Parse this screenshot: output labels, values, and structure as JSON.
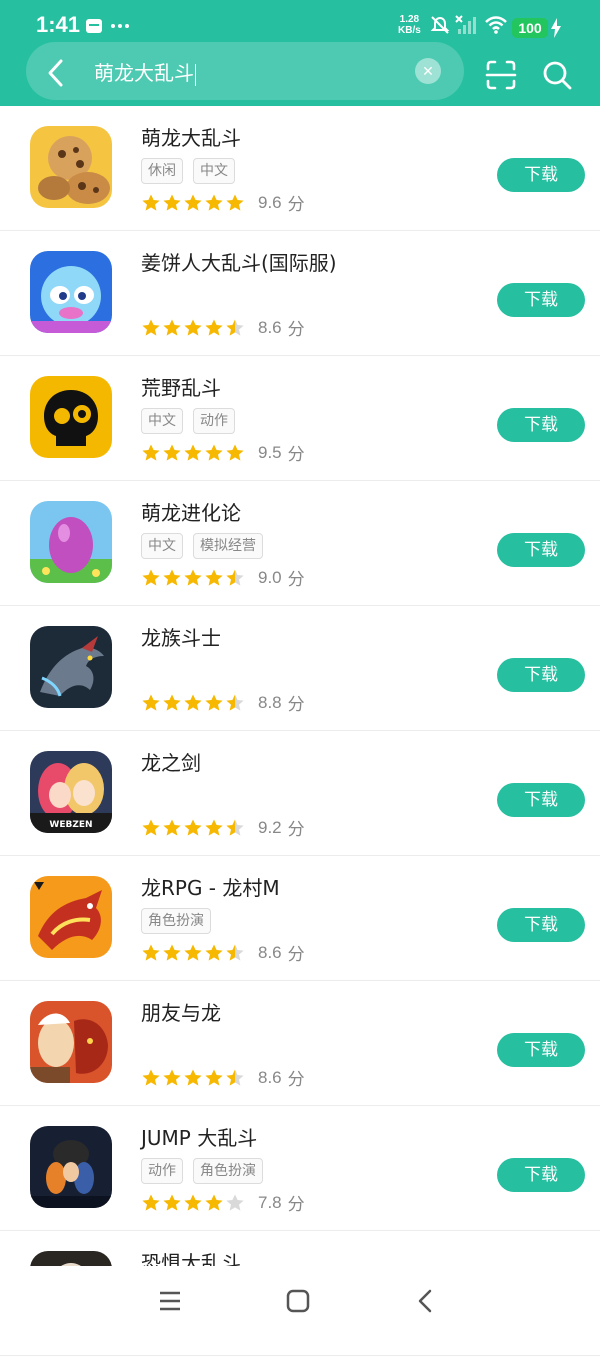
{
  "status_bar": {
    "time": "1:41",
    "net_speed_value": "1.28",
    "net_speed_unit": "KB/s",
    "battery": "100"
  },
  "search": {
    "query": "萌龙大乱斗"
  },
  "colors": {
    "accent": "#26bfa0",
    "star": "#f6b800",
    "star_empty": "#d9d9d9"
  },
  "download_label": "下载",
  "score_unit": "分",
  "apps": [
    {
      "name": "萌龙大乱斗",
      "tags": [
        "休闲",
        "中文"
      ],
      "score": "9.6",
      "stars": 5
    },
    {
      "name": "姜饼人大乱斗(国际服)",
      "tags": [],
      "score": "8.6",
      "stars": 4.5
    },
    {
      "name": "荒野乱斗",
      "tags": [
        "中文",
        "动作"
      ],
      "score": "9.5",
      "stars": 5
    },
    {
      "name": "萌龙进化论",
      "tags": [
        "中文",
        "模拟经营"
      ],
      "score": "9.0",
      "stars": 4.5
    },
    {
      "name": "龙族斗士",
      "tags": [],
      "score": "8.8",
      "stars": 4.5
    },
    {
      "name": "龙之剑",
      "tags": [],
      "score": "9.2",
      "stars": 4.5,
      "icon_text": "WEBZEN"
    },
    {
      "name": "龙RPG - 龙村M",
      "tags": [
        "角色扮演"
      ],
      "score": "8.6",
      "stars": 4.5
    },
    {
      "name": "朋友与龙",
      "tags": [],
      "score": "8.6",
      "stars": 4.5
    },
    {
      "name": "JUMP 大乱斗",
      "tags": [
        "动作",
        "角色扮演"
      ],
      "score": "7.8",
      "stars": 4
    },
    {
      "name": "恐惧大乱斗",
      "tags": [],
      "score": "",
      "stars": 0
    }
  ]
}
